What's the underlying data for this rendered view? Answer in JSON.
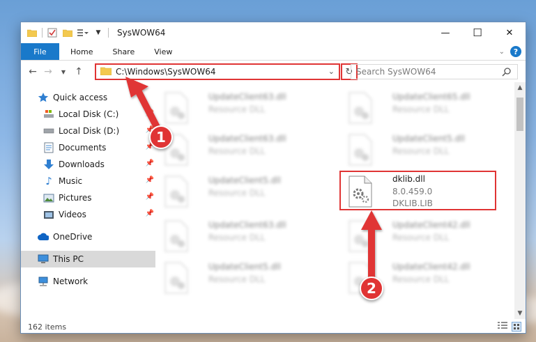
{
  "window": {
    "title": "SysWOW64",
    "controls": {
      "minimize": "—",
      "maximize": "☐",
      "close": "✕"
    }
  },
  "ribbon": {
    "tabs": [
      {
        "label": "File"
      },
      {
        "label": "Home"
      },
      {
        "label": "Share"
      },
      {
        "label": "View"
      }
    ],
    "help": "?"
  },
  "navigation": {
    "address": "C:\\Windows\\SysWOW64",
    "search_placeholder": "Search SysWOW64"
  },
  "sidebar": {
    "items": [
      {
        "label": "Quick access",
        "icon": "star-icon"
      },
      {
        "label": "Local Disk (C:)",
        "icon": "drive-icon"
      },
      {
        "label": "Local Disk (D:)",
        "icon": "drive-icon"
      },
      {
        "label": "Documents",
        "icon": "documents-icon"
      },
      {
        "label": "Downloads",
        "icon": "download-icon"
      },
      {
        "label": "Music",
        "icon": "music-icon"
      },
      {
        "label": "Pictures",
        "icon": "pictures-icon"
      },
      {
        "label": "Videos",
        "icon": "videos-icon"
      },
      {
        "label": "OneDrive",
        "icon": "cloud-icon"
      },
      {
        "label": "This PC",
        "icon": "computer-icon"
      },
      {
        "label": "Network",
        "icon": "network-icon"
      }
    ]
  },
  "files": [
    {
      "name": "UpdateClient63.dll",
      "type": "Resource DLL"
    },
    {
      "name": "UpdateClient65.dll",
      "type": "Resource DLL"
    },
    {
      "name": "UpdateClient63.dll",
      "type": "Resource DLL"
    },
    {
      "name": "UpdateClient5.dll",
      "type": "Resource DLL"
    },
    {
      "name": "UpdateClient5.dll",
      "type": "Resource DLL"
    },
    {
      "name": "dklib.dll",
      "version": "8.0.459.0",
      "description": "DKLIB.LIB"
    },
    {
      "name": "UpdateClient63.dll",
      "type": "Resource DLL"
    },
    {
      "name": "UpdateClient42.dll",
      "type": "Resource DLL"
    },
    {
      "name": "UpdateClient5.dll",
      "type": "Resource DLL"
    },
    {
      "name": "UpdateClient42.dll",
      "type": "Resource DLL"
    }
  ],
  "status": {
    "item_count": "162 items"
  },
  "callouts": {
    "first": "1",
    "second": "2"
  },
  "colors": {
    "accent": "#1979ca",
    "highlight": "#e03434"
  }
}
